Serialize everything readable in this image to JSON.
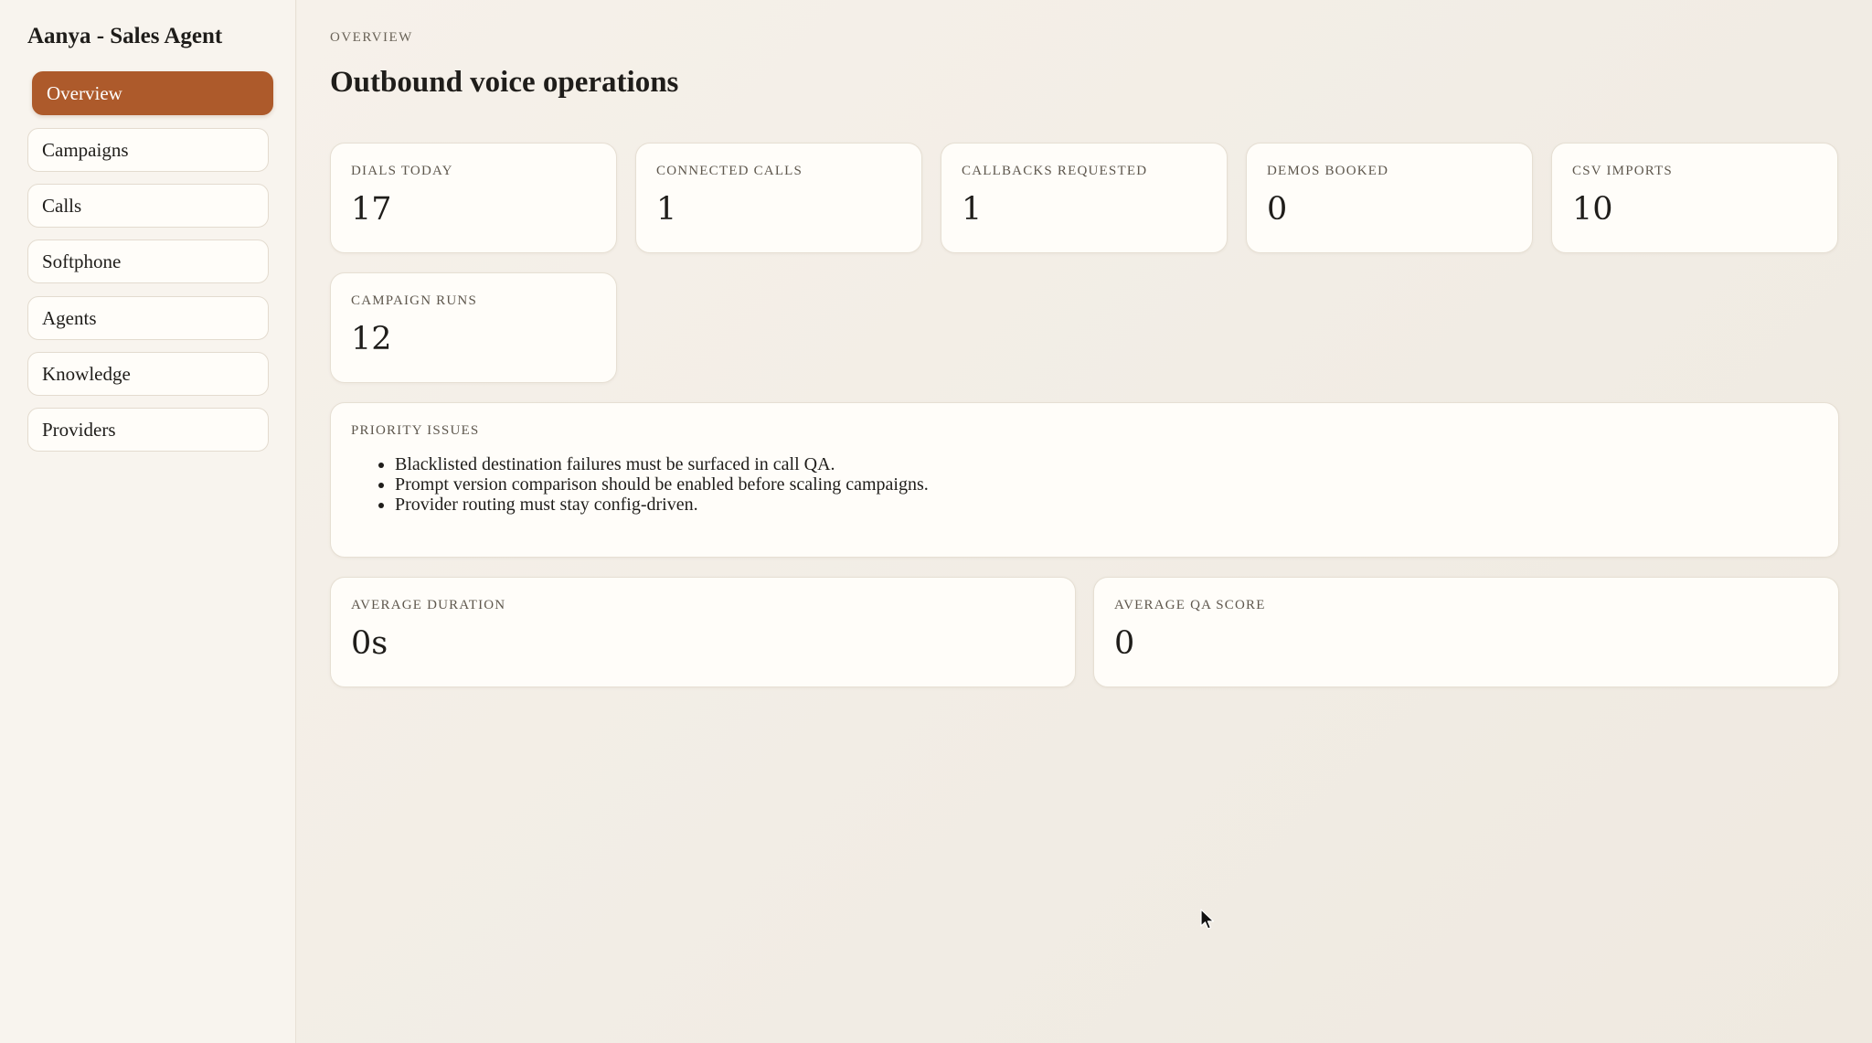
{
  "sidebar": {
    "brand": "Aanya - Sales Agent",
    "items": [
      {
        "label": "Overview",
        "active": true
      },
      {
        "label": "Campaigns",
        "active": false
      },
      {
        "label": "Calls",
        "active": false
      },
      {
        "label": "Softphone",
        "active": false
      },
      {
        "label": "Agents",
        "active": false
      },
      {
        "label": "Knowledge",
        "active": false
      },
      {
        "label": "Providers",
        "active": false
      }
    ]
  },
  "header": {
    "eyebrow": "OVERVIEW",
    "title": "Outbound voice operations"
  },
  "stats": [
    {
      "label": "DIALS TODAY",
      "value": "17"
    },
    {
      "label": "CONNECTED CALLS",
      "value": "1"
    },
    {
      "label": "CALLBACKS REQUESTED",
      "value": "1"
    },
    {
      "label": "DEMOS BOOKED",
      "value": "0"
    },
    {
      "label": "CSV IMPORTS",
      "value": "10"
    },
    {
      "label": "CAMPAIGN RUNS",
      "value": "12"
    }
  ],
  "priority_issues": {
    "label": "PRIORITY ISSUES",
    "items": [
      "Blacklisted destination failures must be surfaced in call QA.",
      "Prompt version comparison should be enabled before scaling campaigns.",
      "Provider routing must stay config-driven."
    ]
  },
  "averages": [
    {
      "label": "AVERAGE DURATION",
      "value": "0s"
    },
    {
      "label": "AVERAGE QA SCORE",
      "value": "0"
    }
  ],
  "colors": {
    "accent": "#ad5a2b",
    "background": "#f3eee6",
    "card": "#fffdf9"
  }
}
